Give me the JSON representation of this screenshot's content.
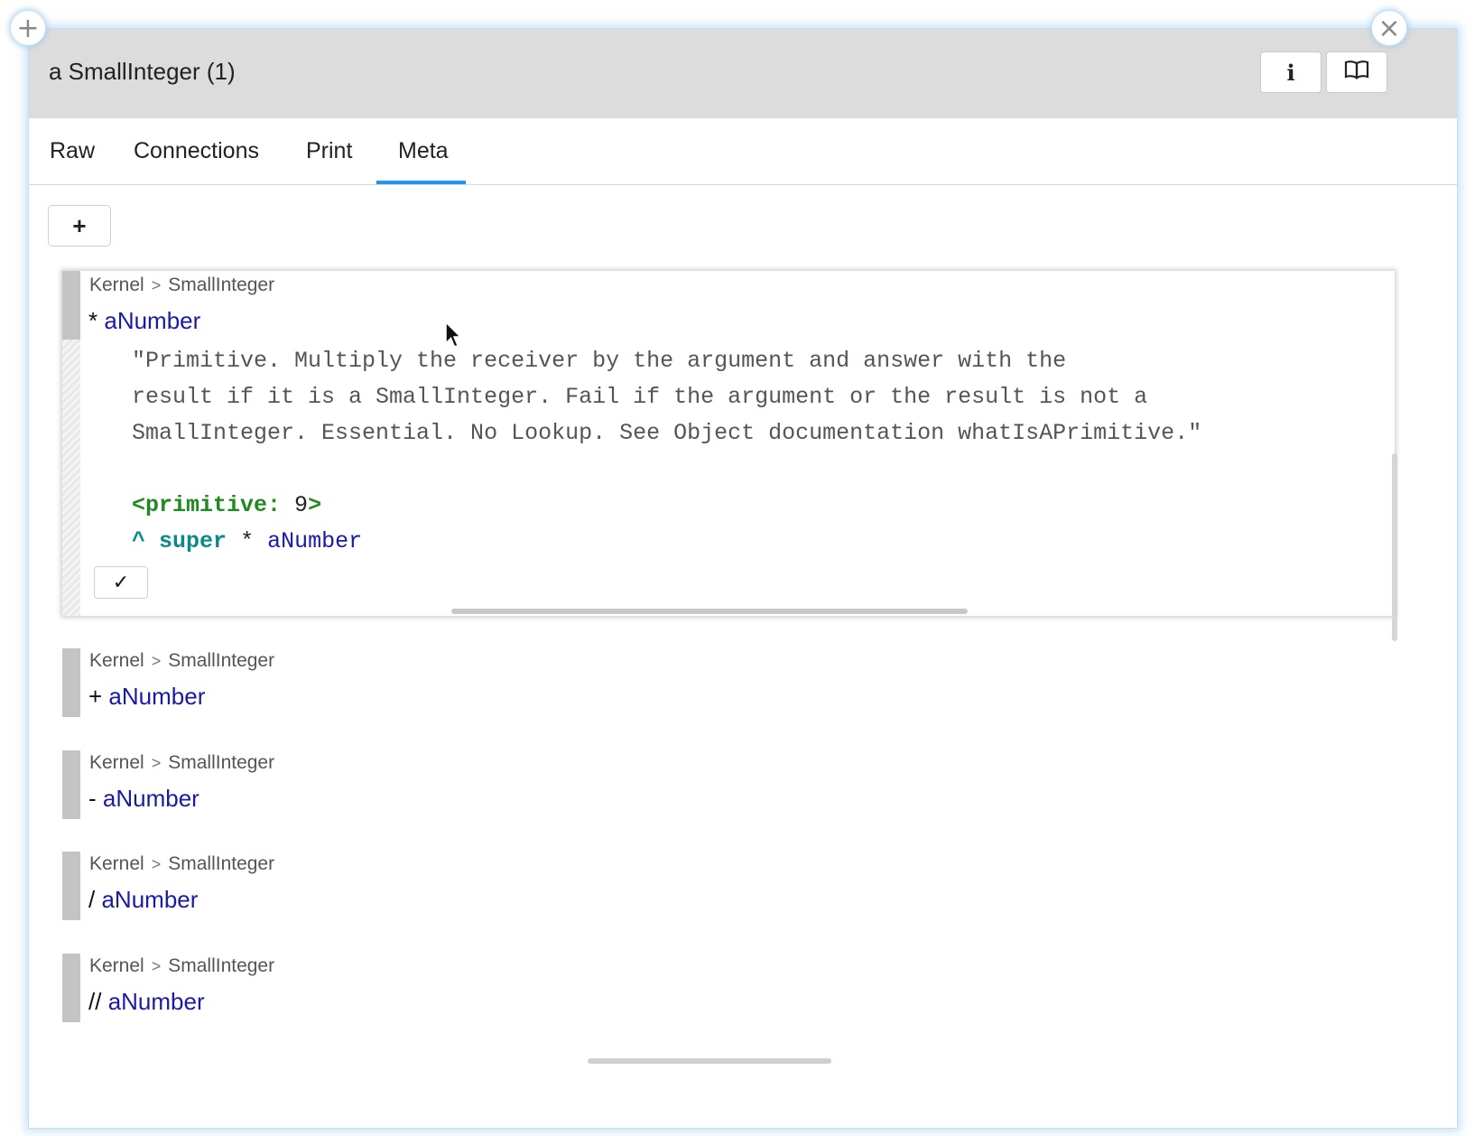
{
  "window": {
    "title": "a SmallInteger (1)",
    "info_label": "i",
    "add_corner_label": "+",
    "close_corner_label": "×"
  },
  "tabs": [
    {
      "label": "Raw",
      "selected": false
    },
    {
      "label": "Connections",
      "selected": false
    },
    {
      "label": "Print",
      "selected": false
    },
    {
      "label": "Meta",
      "selected": true
    }
  ],
  "toolbar": {
    "add_label": "+"
  },
  "expanded_method": {
    "package": "Kernel",
    "separator": ">",
    "class": "SmallInteger",
    "selector": "*",
    "argument": "aNumber",
    "comment_lines": [
      "\"Primitive. Multiply the receiver by the argument and answer with the",
      "result if it is a SmallInteger. Fail if the argument or the result is not a",
      "SmallInteger. Essential. No Lookup. See Object documentation whatIsAPrimitive.\""
    ],
    "primitive_pragma": "<primitive:",
    "primitive_number": "9",
    "primitive_close": ">",
    "return_caret": "^",
    "return_receiver": "super",
    "return_operator": "*",
    "return_argument": "aNumber",
    "accept_label": "✓"
  },
  "methods": [
    {
      "package": "Kernel",
      "separator": ">",
      "class": "SmallInteger",
      "selector": "+",
      "argument": "aNumber"
    },
    {
      "package": "Kernel",
      "separator": ">",
      "class": "SmallInteger",
      "selector": "-",
      "argument": "aNumber"
    },
    {
      "package": "Kernel",
      "separator": ">",
      "class": "SmallInteger",
      "selector": "/",
      "argument": "aNumber"
    },
    {
      "package": "Kernel",
      "separator": ">",
      "class": "SmallInteger",
      "selector": "//",
      "argument": "aNumber"
    }
  ],
  "colors": {
    "accent_tab_underline": "#2196f3",
    "titlebar_bg": "#dcdcdc",
    "argument_blue": "#1a1aa6",
    "pragma_green": "#1f8a1f",
    "super_teal": "#0b8a8a"
  }
}
